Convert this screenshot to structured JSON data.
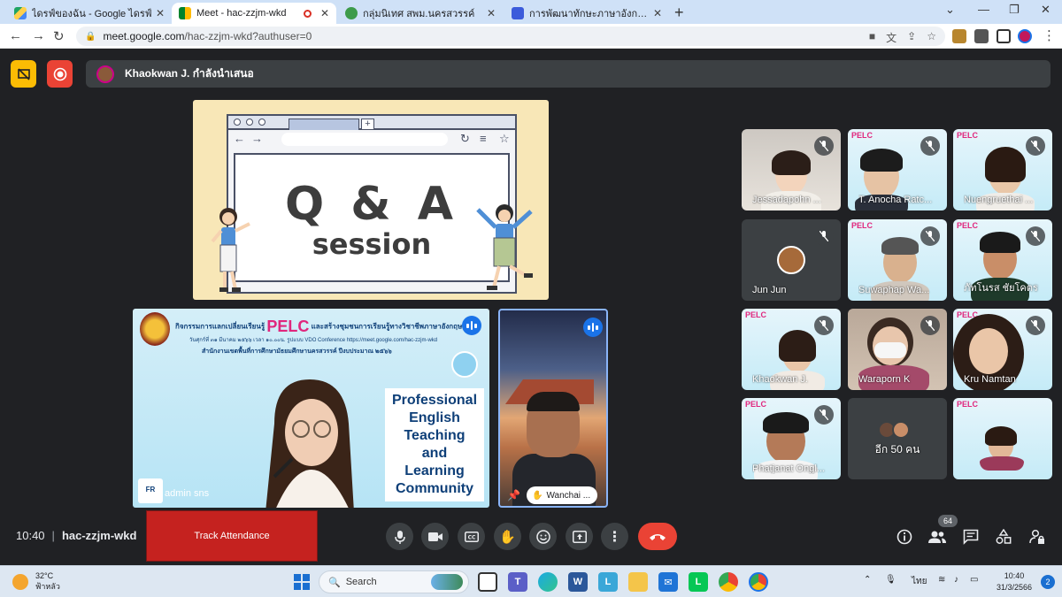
{
  "browser": {
    "tabs": [
      {
        "title": "ไดรฟ์ของฉัน - Google ไดรฟ์",
        "active": false
      },
      {
        "title": "Meet - hac-zzjm-wkd",
        "active": true
      },
      {
        "title": "กลุ่มนิเทศ สพม.นครสวรรค์",
        "active": false
      },
      {
        "title": "การพัฒนาทักษะภาษาอังกฤษ English",
        "active": false
      }
    ],
    "new_tab": "+",
    "url_host": "meet.google.com",
    "url_path": "/hac-zzjm-wkd?authuser=0"
  },
  "meet": {
    "presenter_banner": "Khaokwan J. กำลังนำเสนอ",
    "qa_slide": {
      "title": "Q & A",
      "subtitle": "session"
    },
    "shared_screen": {
      "header_line1": "กิจกรรมการแลกเปลี่ยนเรียนรู้",
      "header_pelc": "PELC",
      "header_line1b": "และสร้างชุมชนการเรียนรู้ทางวิชาชีพภาษาอังกฤษ",
      "header_line2": "วันศุกร์ที่ ๓๑ มีนาคม ๒๕๖๖ เวลา ๑๐.๐๐น. รูปแบบ VDO Conference https://meet.google.com/hac-zzjm-wkd",
      "header_line3": "สำนักงานเขตพื้นที่การศึกษามัธยมศึกษานครสวรรค์  ปีงบประมาณ ๒๕๖๖",
      "box_lines": [
        "Professional",
        "English",
        "Teaching",
        "and",
        "Learning",
        "Community"
      ],
      "owner": "admin sns",
      "badge": "FR"
    },
    "focus_tile": {
      "name": "Wanchai ..."
    },
    "participants": [
      {
        "name": "Jessadapohn ...",
        "type": "camera"
      },
      {
        "name": "T. Anocha Ratc...",
        "type": "slide"
      },
      {
        "name": "Nuengruethai ...",
        "type": "slide"
      },
      {
        "name": "Jun Jun",
        "type": "avatar"
      },
      {
        "name": "Suwaphap Wa...",
        "type": "slide"
      },
      {
        "name": "ภัทโนรส ชัยโคตร",
        "type": "slide"
      },
      {
        "name": "Khaokwan J.",
        "type": "slide"
      },
      {
        "name": "Waraporn K",
        "type": "camera"
      },
      {
        "name": "Kru Namtan",
        "type": "camera"
      },
      {
        "name": "Phatjanat Ongl...",
        "type": "slide"
      },
      {
        "name": "อีก 50 คน",
        "type": "more"
      },
      {
        "name": "",
        "type": "slide"
      }
    ],
    "meeting_time": "10:40",
    "meeting_code": "hac-zzjm-wkd",
    "track_attendance": "Track Attendance",
    "people_count": "64"
  },
  "taskbar": {
    "temperature": "32°C",
    "weather": "ฟ้าหลัว",
    "search_placeholder": "Search",
    "language": "ไทย",
    "time": "10:40",
    "date": "31/3/2566",
    "notifications": "2"
  },
  "colors": {
    "end_call": "#ea4335",
    "meet_bg": "#202124",
    "record": "#ea4335",
    "accent_pink": "#e0267d"
  }
}
